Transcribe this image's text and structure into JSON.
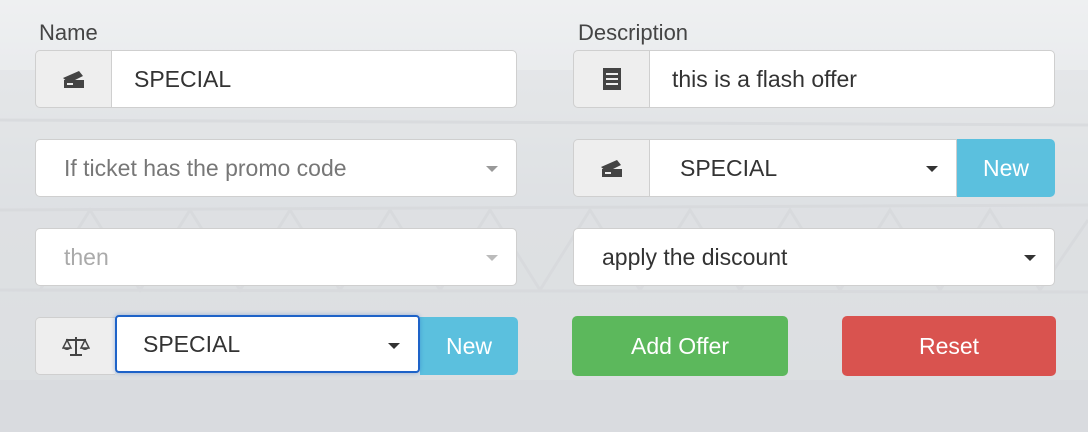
{
  "labels": {
    "name": "Name",
    "description": "Description"
  },
  "name_field": {
    "value": "SPECIAL",
    "icon": "ticket-icon"
  },
  "description_field": {
    "value": "this is a flash offer",
    "icon": "document-icon"
  },
  "condition_select": {
    "value": "If ticket has the promo code"
  },
  "promo_group": {
    "icon": "ticket-icon",
    "value": "SPECIAL",
    "new_label": "New"
  },
  "then_select": {
    "value": "then"
  },
  "action_select": {
    "value": "apply the discount"
  },
  "discount_group": {
    "icon": "scale-icon",
    "value": "SPECIAL",
    "new_label": "New"
  },
  "buttons": {
    "add_offer": "Add Offer",
    "reset": "Reset"
  },
  "colors": {
    "info": "#5bc0de",
    "success": "#5cb85c",
    "danger": "#d9534f",
    "focus": "#1e63c8"
  }
}
